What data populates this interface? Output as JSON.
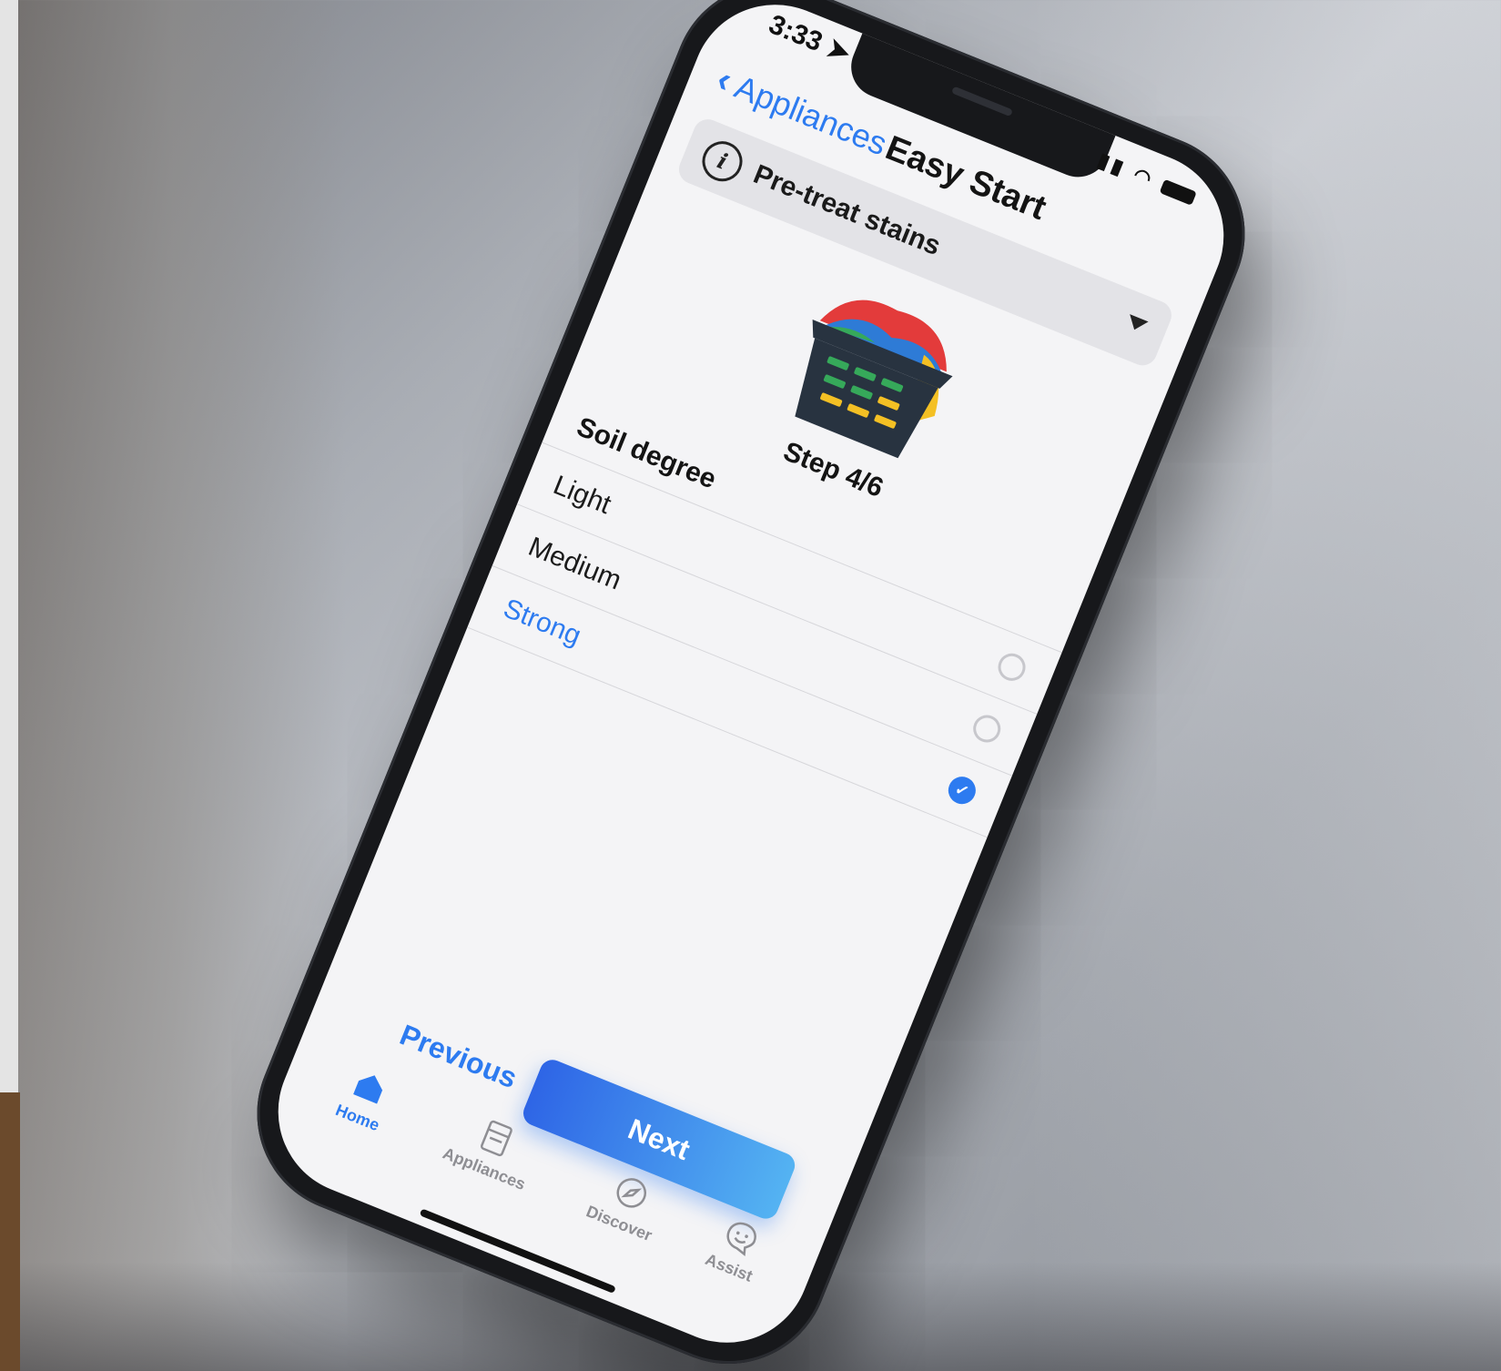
{
  "status_bar": {
    "time": "3:33"
  },
  "nav": {
    "back_label": "Appliances",
    "title": "Easy Start"
  },
  "tip": {
    "text": "Pre-treat stains"
  },
  "step": {
    "label": "Step 4/6"
  },
  "soil": {
    "section_label": "Soil degree",
    "options": [
      {
        "label": "Light",
        "selected": false
      },
      {
        "label": "Medium",
        "selected": false
      },
      {
        "label": "Strong",
        "selected": true
      }
    ]
  },
  "actions": {
    "previous_label": "Previous",
    "next_label": "Next"
  },
  "tabbar": {
    "items": [
      {
        "label": "Home",
        "icon": "home-icon",
        "active": true
      },
      {
        "label": "Appliances",
        "icon": "appliance-icon",
        "active": false
      },
      {
        "label": "Discover",
        "icon": "compass-icon",
        "active": false
      },
      {
        "label": "Assist",
        "icon": "smiley-chat-icon",
        "active": false
      }
    ]
  },
  "colors": {
    "accent": "#2d7bf0",
    "notification_dot": "#e5162c"
  }
}
